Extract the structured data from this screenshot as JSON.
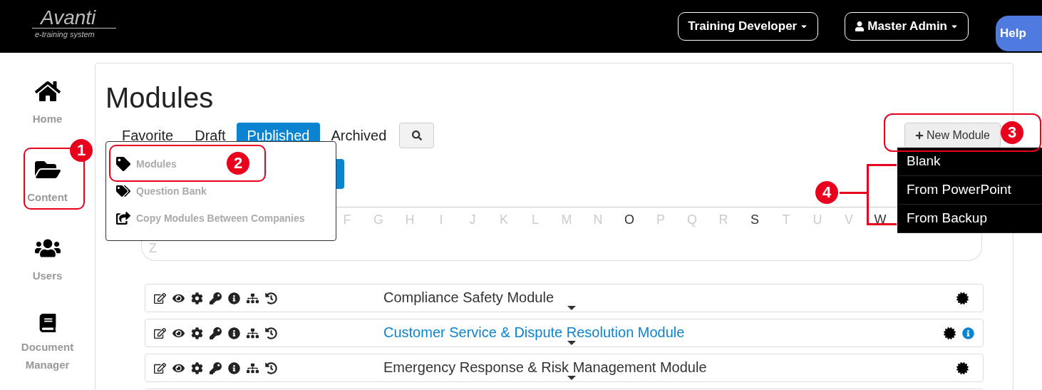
{
  "header": {
    "logo": {
      "name": "Avanti",
      "tagline": "e-training system"
    },
    "role_button": "Training Developer",
    "user_button": "Master Admin",
    "help_button": "Help"
  },
  "sidebar": {
    "items": [
      {
        "kind": "home",
        "label": "Home"
      },
      {
        "kind": "content",
        "label": "Content"
      },
      {
        "kind": "users",
        "label": "Users"
      },
      {
        "kind": "documents",
        "label": "Document Manager"
      }
    ]
  },
  "page": {
    "title": "Modules",
    "tabs": [
      {
        "label": "Favorite",
        "selected": false
      },
      {
        "label": "Draft",
        "selected": false
      },
      {
        "label": "Published",
        "selected": true
      },
      {
        "label": "Archived",
        "selected": false
      }
    ],
    "new_module_button": "New Module",
    "new_module_menu": [
      "Blank",
      "From PowerPoint",
      "From Backup"
    ],
    "content_menu": [
      {
        "kind": "tag",
        "label": "Modules"
      },
      {
        "kind": "tags",
        "label": "Question Bank"
      },
      {
        "kind": "share",
        "label": "Copy Modules Between Companies"
      }
    ],
    "letters": [
      {
        "label": "F",
        "enabled": false
      },
      {
        "label": "G",
        "enabled": false
      },
      {
        "label": "H",
        "enabled": false
      },
      {
        "label": "I",
        "enabled": false
      },
      {
        "label": "J",
        "enabled": false
      },
      {
        "label": "K",
        "enabled": false
      },
      {
        "label": "L",
        "enabled": false
      },
      {
        "label": "M",
        "enabled": false
      },
      {
        "label": "N",
        "enabled": false
      },
      {
        "label": "O",
        "enabled": true
      },
      {
        "label": "P",
        "enabled": false
      },
      {
        "label": "Q",
        "enabled": false
      },
      {
        "label": "R",
        "enabled": false
      },
      {
        "label": "S",
        "enabled": true
      },
      {
        "label": "T",
        "enabled": false
      },
      {
        "label": "U",
        "enabled": false
      },
      {
        "label": "V",
        "enabled": false
      },
      {
        "label": "W",
        "enabled": true
      },
      {
        "label": "Z",
        "enabled": false
      }
    ],
    "rows": [
      {
        "title": "Compliance Safety Module",
        "linked": false,
        "has_info": false
      },
      {
        "title": "Customer Service & Dispute Resolution Module",
        "linked": true,
        "has_info": true
      },
      {
        "title": "Emergency Response & Risk Management Module",
        "linked": false,
        "has_info": false
      }
    ]
  },
  "callouts": [
    "1",
    "2",
    "3",
    "4"
  ]
}
